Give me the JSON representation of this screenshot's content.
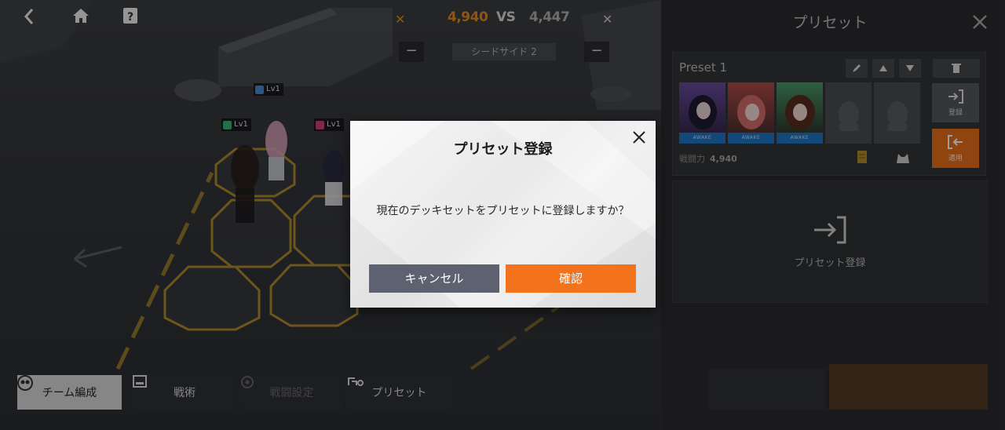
{
  "top_bar": {
    "back_icon": "chevron-left-icon",
    "home_icon": "home-icon",
    "help_icon": "question-icon",
    "left_score": "4,940",
    "vs_label": "VS",
    "right_score": "4,447",
    "cross_left": "✕",
    "cross_right": "✕",
    "side_label": "シードサイド 2",
    "left_score_color": "#e98a1f",
    "right_score_color": "#b0b0b0"
  },
  "field": {
    "level_tags": [
      {
        "label": "Lv1",
        "color": "#4a8ad8"
      },
      {
        "label": "Lv1",
        "color": "#3cb07a"
      },
      {
        "label": "Lv1",
        "color": "#d0407a"
      }
    ]
  },
  "bottom_tabs": [
    {
      "label": "チーム編成",
      "icon": "team-icon",
      "state": "active"
    },
    {
      "label": "戦術",
      "icon": "tactics-icon",
      "state": "normal"
    },
    {
      "label": "戦闘設定",
      "icon": "battle-settings-icon",
      "state": "disabled"
    },
    {
      "label": "プリセット",
      "icon": "preset-icon",
      "state": "normal"
    }
  ],
  "panel": {
    "title": "プリセット",
    "preset_name": "Preset 1",
    "portrait_strip": "AWAKE",
    "power_label": "戦闘力",
    "power_value": "4,940",
    "side_register_label": "登録",
    "side_apply_label": "適用",
    "register_label": "プリセット登録",
    "accent": "#e8701a"
  },
  "modal": {
    "title": "プリセット登録",
    "message": "現在のデッキセットをプリセットに登録しますか？",
    "cancel_label": "キャンセル",
    "confirm_label": "確認",
    "cancel_color": "#5e6270",
    "confirm_color": "#f2731c"
  }
}
